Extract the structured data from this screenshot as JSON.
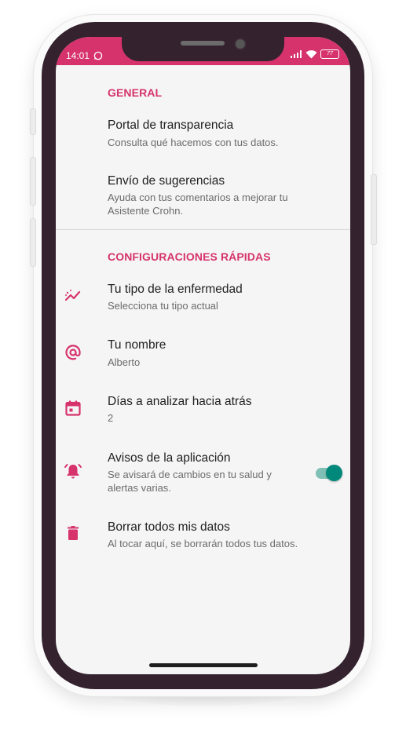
{
  "status_bar": {
    "time": "14:01",
    "battery": "77",
    "color": "#d6336c"
  },
  "sections": {
    "general": {
      "title": "GENERAL",
      "items": [
        {
          "title": "Portal de transparencia",
          "subtitle": "Consulta qué hacemos con tus datos."
        },
        {
          "title": "Envío de sugerencias",
          "subtitle": "Ayuda con tus comentarios a mejorar tu Asistente Crohn."
        }
      ]
    },
    "quick": {
      "title": "CONFIGURACIONES RÁPIDAS",
      "items": [
        {
          "icon": "trending-chart-icon",
          "title": "Tu tipo de la enfermedad",
          "subtitle": "Selecciona tu tipo actual"
        },
        {
          "icon": "at-sign-icon",
          "title": "Tu nombre",
          "subtitle": "Alberto"
        },
        {
          "icon": "calendar-icon",
          "title": "Días a analizar hacia atrás",
          "subtitle": "2"
        },
        {
          "icon": "alarm-bell-icon",
          "title": "Avisos de la aplicación",
          "subtitle": "Se avisará de cambios en tu salud y alertas varias.",
          "toggle_on": true
        },
        {
          "icon": "trash-icon",
          "title": "Borrar todos mis datos",
          "subtitle": "Al tocar aquí, se borrarán todos tus datos."
        }
      ]
    }
  },
  "colors": {
    "accent": "#d6336c",
    "toggle": "#00897b"
  }
}
